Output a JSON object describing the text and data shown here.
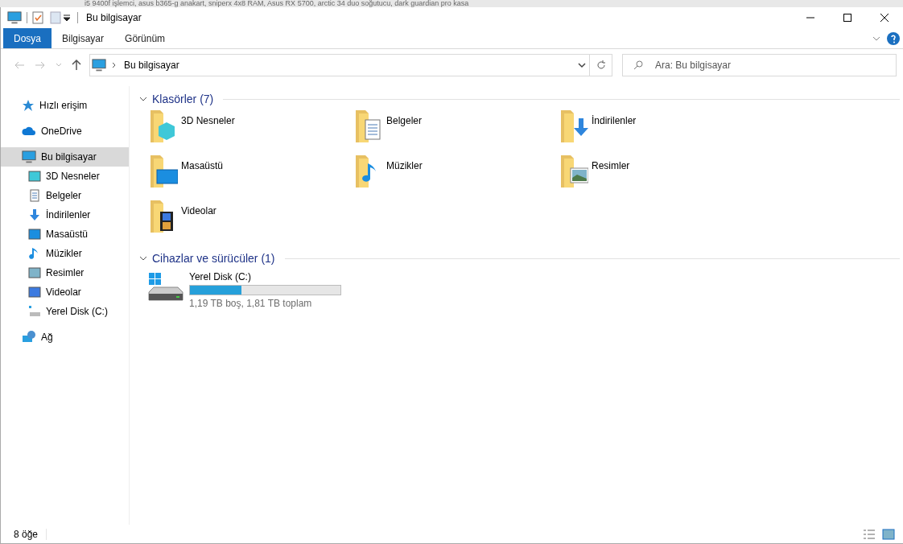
{
  "background_window_text": "i5 9400f işlemci, asus b365-g anakart, sniperx 4x8 RAM, Asus RX 5700, arctic 34 duo soğutucu, dark guardian pro kasa",
  "window": {
    "title": "Bu bilgisayar"
  },
  "ribbon_tabs": [
    {
      "label": "Dosya",
      "selected": true
    },
    {
      "label": "Bilgisayar",
      "selected": false
    },
    {
      "label": "Görünüm",
      "selected": false
    }
  ],
  "address_bar": {
    "path": "Bu bilgisayar"
  },
  "search": {
    "placeholder": "Ara: Bu bilgisayar"
  },
  "sidebar": {
    "items": [
      {
        "label": "Hızlı erişim",
        "selected": false
      },
      {
        "label": "OneDrive",
        "selected": false
      },
      {
        "label": "Bu bilgisayar",
        "selected": true,
        "children": [
          {
            "label": "3D Nesneler",
            "selected": false
          },
          {
            "label": "Belgeler",
            "selected": false
          },
          {
            "label": "İndirilenler",
            "selected": false
          },
          {
            "label": "Masaüstü",
            "selected": false
          },
          {
            "label": "Müzikler",
            "selected": false
          },
          {
            "label": "Resimler",
            "selected": false
          },
          {
            "label": "Videolar",
            "selected": false
          },
          {
            "label": "Yerel Disk (C:)",
            "selected": false
          }
        ]
      },
      {
        "label": "Ağ",
        "selected": false
      }
    ]
  },
  "sections": [
    {
      "title": "Klasörler (7)",
      "expanded": true,
      "kind": "folders",
      "items": [
        {
          "name": "3D Nesneler"
        },
        {
          "name": "Belgeler"
        },
        {
          "name": "İndirilenler"
        },
        {
          "name": "Masaüstü"
        },
        {
          "name": "Müzikler"
        },
        {
          "name": "Resimler"
        },
        {
          "name": "Videolar"
        }
      ]
    },
    {
      "title": "Cihazlar ve sürücüler (1)",
      "expanded": true,
      "kind": "drives",
      "items": [
        {
          "name": "Yerel Disk (C:)",
          "level": 0.34,
          "space": "1,19 TB boş, 1,81 TB toplam"
        }
      ]
    }
  ],
  "status_bar": {
    "count": "8 öğe"
  }
}
